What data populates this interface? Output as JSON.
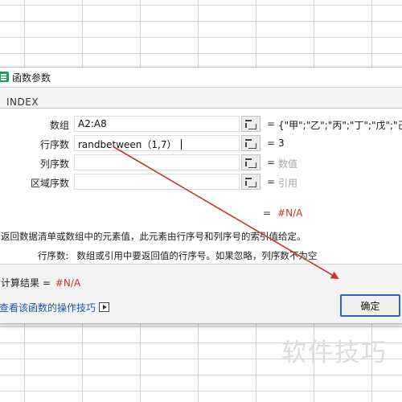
{
  "dialog": {
    "title": "函数参数",
    "function_name": "INDEX",
    "rows": [
      {
        "label": "数组",
        "value": "A2:A8",
        "result": "{\"甲\";\"乙\";\"丙\";\"丁\";\"戊\";\"己\";",
        "result_muted": false
      },
      {
        "label": "行序数",
        "value": "randbetween（1,7）",
        "result": "3",
        "result_muted": false
      },
      {
        "label": "列序数",
        "value": "",
        "result": "数值",
        "result_muted": true
      },
      {
        "label": "区域序数",
        "value": "",
        "result": "引用",
        "result_muted": true
      }
    ],
    "equals_sign": "=",
    "formula_result": "#N/A",
    "description": "返回数据清单或数组中的元素值，此元素由行序号和列序号的索引值给定。",
    "param_name": "行序数:",
    "param_description": "数组或引用中要返回值的行序号。如果忽略，列序数不为空",
    "calc_label": "计算结果 =",
    "calc_value": "#N/A",
    "help_link": "查看该函数的操作技巧",
    "ok_label": "确定"
  },
  "watermark": "软件技巧",
  "colors": {
    "accent": "#2a66c7",
    "error": "#c0392b",
    "annotation_arrow": "#c0392b",
    "app_icon": "#1e9e5b"
  }
}
